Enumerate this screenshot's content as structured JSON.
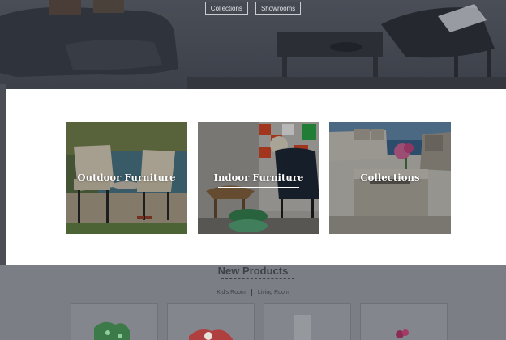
{
  "hero": {
    "buttons": [
      "Collections",
      "Showrooms"
    ]
  },
  "modal": {
    "tiles": [
      {
        "label": "Outdoor Furniture"
      },
      {
        "label": "Indoor Furniture"
      },
      {
        "label": "Collections"
      }
    ]
  },
  "new_products": {
    "title": "New Products",
    "tabs": [
      "Kid's Room",
      "Living Room"
    ]
  },
  "colors": {
    "modal_bg": "#ffffff",
    "overlay": "#5a5d63",
    "tile_text": "#ffffff"
  }
}
